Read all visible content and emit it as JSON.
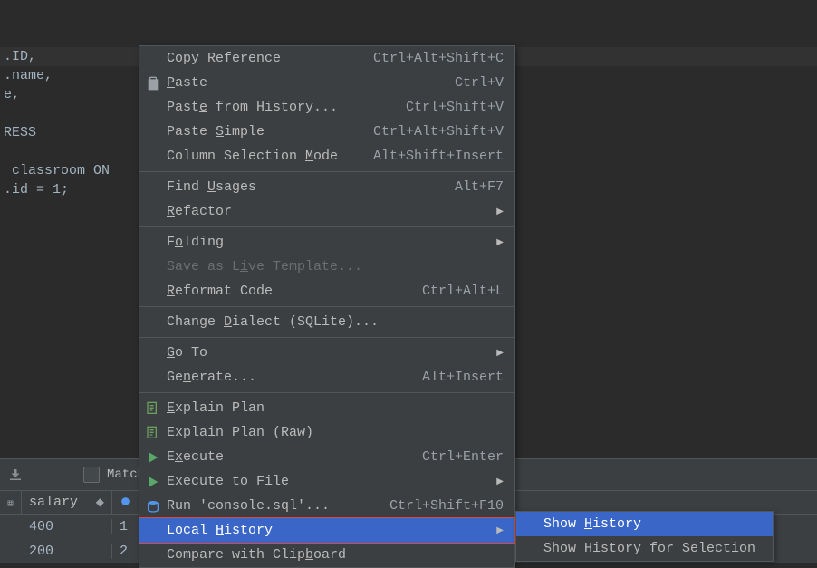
{
  "editor": {
    "lines": [
      ".ID,",
      ".name,",
      "e,",
      "",
      "RESS",
      "",
      " classroom ON",
      ".id = 1;"
    ]
  },
  "context_menu": {
    "items": [
      {
        "label_pre": "Copy ",
        "label_u": "R",
        "label_post": "eference",
        "shortcut": "Ctrl+Alt+Shift+C"
      },
      {
        "label_pre": "",
        "label_u": "P",
        "label_post": "aste",
        "shortcut": "Ctrl+V",
        "icon": "clipboard"
      },
      {
        "label_pre": "Past",
        "label_u": "e",
        "label_post": " from History...",
        "shortcut": "Ctrl+Shift+V"
      },
      {
        "label_pre": "Paste ",
        "label_u": "S",
        "label_post": "imple",
        "shortcut": "Ctrl+Alt+Shift+V"
      },
      {
        "label_pre": "Column Selection ",
        "label_u": "M",
        "label_post": "ode",
        "shortcut": "Alt+Shift+Insert"
      },
      {
        "sep": true
      },
      {
        "label_pre": "Find ",
        "label_u": "U",
        "label_post": "sages",
        "shortcut": "Alt+F7"
      },
      {
        "label_pre": "",
        "label_u": "R",
        "label_post": "efactor",
        "submenu": true
      },
      {
        "sep": true
      },
      {
        "label_pre": "F",
        "label_u": "o",
        "label_post": "lding",
        "submenu": true
      },
      {
        "label_pre": "Save as L",
        "label_u": "i",
        "label_post": "ve Template...",
        "disabled": true
      },
      {
        "label_pre": "",
        "label_u": "R",
        "label_post": "eformat Code",
        "shortcut": "Ctrl+Alt+L"
      },
      {
        "sep": true
      },
      {
        "label_pre": "Change ",
        "label_u": "D",
        "label_post": "ialect (SQLite)..."
      },
      {
        "sep": true
      },
      {
        "label_pre": "",
        "label_u": "G",
        "label_post": "o To",
        "submenu": true
      },
      {
        "label_pre": "Ge",
        "label_u": "n",
        "label_post": "erate...",
        "shortcut": "Alt+Insert"
      },
      {
        "sep": true
      },
      {
        "label_pre": "",
        "label_u": "E",
        "label_post": "xplain Plan",
        "icon": "explain"
      },
      {
        "label_pre": "Explain Plan (Raw)",
        "label_u": "",
        "label_post": "",
        "icon": "explain2"
      },
      {
        "label_pre": "E",
        "label_u": "x",
        "label_post": "ecute",
        "shortcut": "Ctrl+Enter",
        "icon": "play"
      },
      {
        "label_pre": "Execute to ",
        "label_u": "F",
        "label_post": "ile",
        "submenu": true,
        "icon": "play2"
      },
      {
        "label_pre": "Run 'console.sql'...",
        "label_u": "",
        "label_post": "",
        "shortcut": "Ctrl+Shift+F10",
        "icon": "db"
      },
      {
        "label_pre": "Local ",
        "label_u": "H",
        "label_post": "istory",
        "submenu": true,
        "highlighted": true
      },
      {
        "label_pre": "Compare with Clip",
        "label_u": "b",
        "label_post": "oard"
      }
    ]
  },
  "sub_menu": {
    "items": [
      {
        "label_pre": "Show ",
        "label_u": "H",
        "label_post": "istory",
        "highlighted": true
      },
      {
        "label_pre": "Show History for Selection",
        "label_u": "",
        "label_post": ""
      }
    ]
  },
  "bottom": {
    "match_label": "Match",
    "column1": "salary",
    "rows": [
      {
        "c2": "400",
        "c3": "1"
      },
      {
        "c2": "200",
        "c3": "2"
      }
    ]
  }
}
